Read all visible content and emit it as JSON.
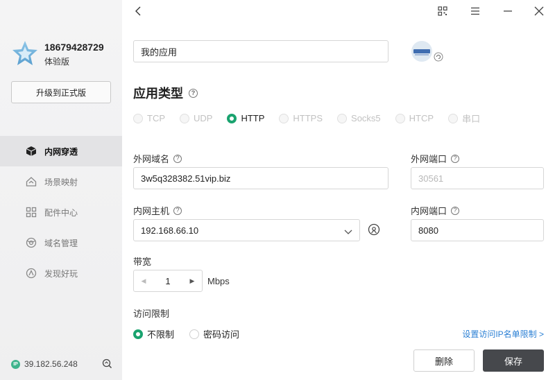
{
  "user": {
    "phone": "18679428729",
    "edition": "体验版"
  },
  "sidebar": {
    "upgrade_label": "升级到正式版",
    "items": [
      {
        "label": "内网穿透",
        "icon": "cube-icon"
      },
      {
        "label": "场景映射",
        "icon": "house-icon"
      },
      {
        "label": "配件中心",
        "icon": "grid-icon"
      },
      {
        "label": "域名管理",
        "icon": "globe-icon"
      },
      {
        "label": "发现好玩",
        "icon": "compass-icon"
      }
    ],
    "ip_badge": "IP",
    "ip": "39.182.56.248"
  },
  "form": {
    "app_name": "我的应用",
    "app_type_title": "应用类型",
    "protocols": [
      "TCP",
      "UDP",
      "HTTP",
      "HTTPS",
      "Socks5",
      "HTCP",
      "串口"
    ],
    "selected_protocol": "HTTP",
    "ext_domain_label": "外网域名",
    "ext_domain_value": "3w5q328382.51vip.biz",
    "ext_port_label": "外网端口",
    "ext_port_value": "30561",
    "int_host_label": "内网主机",
    "int_host_value": "192.168.66.10",
    "int_port_label": "内网端口",
    "int_port_value": "8080",
    "bandwidth_label": "带宽",
    "bandwidth_value": "1",
    "bandwidth_unit": "Mbps",
    "access_label": "访问限制",
    "access_options": [
      "不限制",
      "密码访问"
    ],
    "access_selected": "不限制",
    "ip_whitelist_link": "设置访问IP名单限制 >",
    "help_glyph": "?"
  },
  "actions": {
    "delete_label": "删除",
    "save_label": "保存"
  },
  "colors": {
    "accent": "#1aa36f",
    "save_button": "#46484c",
    "link": "#2a7fd4"
  }
}
